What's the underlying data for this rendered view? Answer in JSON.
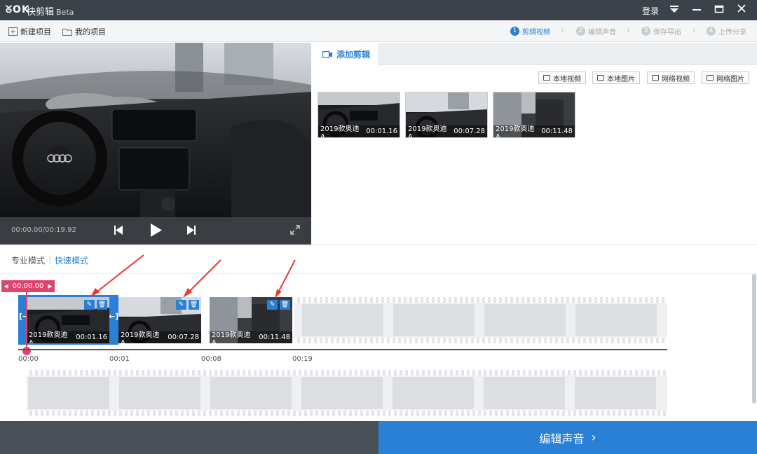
{
  "titlebar": {
    "logo": "ᘜOK",
    "app_name": "快剪辑",
    "beta": "Beta",
    "login": "登录"
  },
  "toolbar": {
    "new_project": "新建项目",
    "my_projects": "我的项目",
    "steps": [
      {
        "num": "1",
        "label": "剪辑视频"
      },
      {
        "num": "2",
        "label": "编辑声音"
      },
      {
        "num": "3",
        "label": "保存导出"
      },
      {
        "num": "4",
        "label": "上传分享"
      }
    ]
  },
  "player": {
    "timecode": "00:00.00/00:19.92"
  },
  "media": {
    "tab": "添加剪辑",
    "sources": [
      "本地视频",
      "本地图片",
      "网络视频",
      "网络图片"
    ],
    "clips": [
      {
        "name": "2019款奥迪A...",
        "duration": "00:01.16"
      },
      {
        "name": "2019款奥迪A...",
        "duration": "00:07.28"
      },
      {
        "name": "2019款奥迪A...",
        "duration": "00:11.48"
      }
    ]
  },
  "modes": {
    "pro": "专业模式",
    "quick": "快速模式"
  },
  "timeline": {
    "playhead_time": "00:00.00",
    "clips": [
      {
        "name": "2019款奥迪A...",
        "duration": "00:01.16"
      },
      {
        "name": "2019款奥迪A...",
        "duration": "00:07.28"
      },
      {
        "name": "2019款奥迪A...",
        "duration": "00:11.48"
      }
    ],
    "ruler": [
      "00:00",
      "00:01",
      "00:08",
      "00:19"
    ]
  },
  "footer": {
    "next_label": "编辑声音"
  },
  "colors": {
    "accent": "#2a7fd6",
    "playhead": "#e0446d",
    "titlebar": "#3c4249",
    "annotation": "#e53a2f"
  }
}
